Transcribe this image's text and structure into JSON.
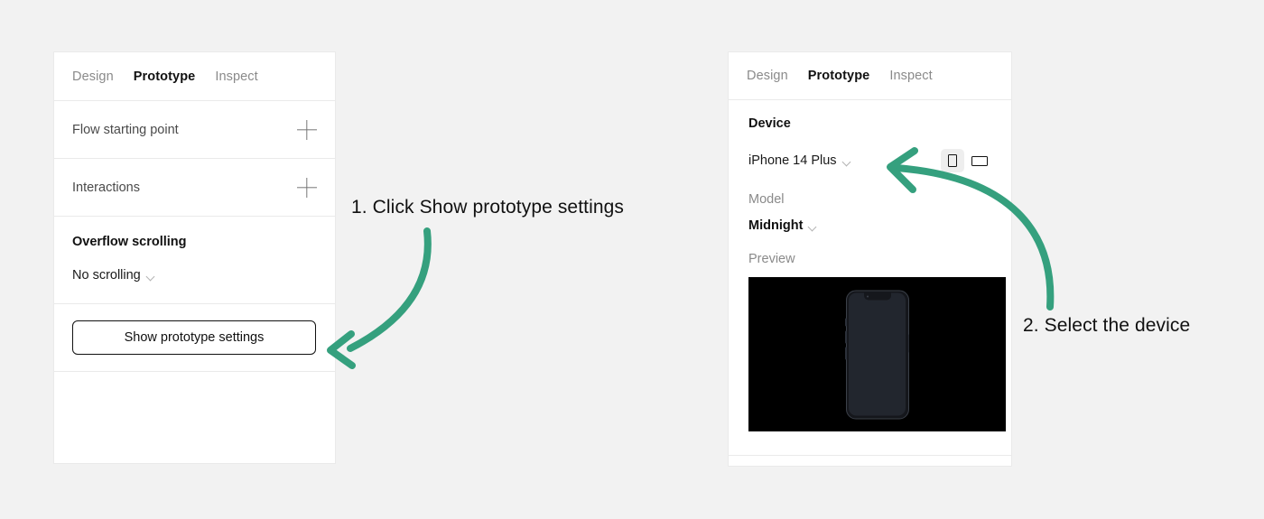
{
  "background_color": "#f2f2f2",
  "accent_color": "#35a07e",
  "left_panel": {
    "tabs": [
      {
        "label": "Design",
        "active": false
      },
      {
        "label": "Prototype",
        "active": true
      },
      {
        "label": "Inspect",
        "active": false
      }
    ],
    "rows": [
      {
        "label": "Flow starting point",
        "action_icon": "plus-icon"
      },
      {
        "label": "Interactions",
        "action_icon": "plus-icon"
      }
    ],
    "overflow": {
      "title": "Overflow scrolling",
      "value": "No scrolling",
      "chevron_icon": "chevron-down-icon"
    },
    "button": {
      "label": "Show prototype settings"
    }
  },
  "right_panel": {
    "tabs": [
      {
        "label": "Design",
        "active": false
      },
      {
        "label": "Prototype",
        "active": true
      },
      {
        "label": "Inspect",
        "active": false
      }
    ],
    "device": {
      "heading": "Device",
      "value": "iPhone 14 Plus",
      "chevron_icon": "chevron-down-icon",
      "orientation": [
        {
          "icon": "portrait-orientation-icon",
          "selected": true
        },
        {
          "icon": "landscape-orientation-icon",
          "selected": false
        }
      ]
    },
    "model": {
      "label": "Model",
      "value": "Midnight",
      "chevron_icon": "chevron-down-icon"
    },
    "preview": {
      "label": "Preview",
      "background_color": "#000000",
      "device_render": "iphone-14-plus-midnight"
    }
  },
  "annotations": [
    {
      "id": "step-1",
      "text": "1. Click Show prototype settings"
    },
    {
      "id": "step-2",
      "text": "2. Select the device"
    }
  ],
  "arrows": [
    {
      "id": "arrow-1",
      "from": "annotation-step-1",
      "to": "show-prototype-settings-button",
      "color": "#35a07e"
    },
    {
      "id": "arrow-2",
      "from": "annotation-step-2",
      "to": "device-select",
      "color": "#35a07e"
    }
  ]
}
